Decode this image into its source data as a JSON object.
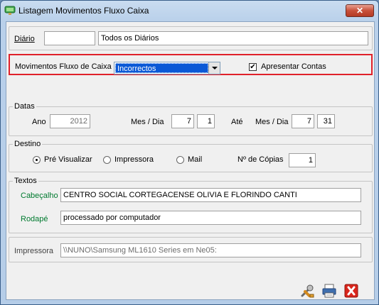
{
  "window": {
    "title": "Listagem Movimentos Fluxo Caixa"
  },
  "diario": {
    "label": "Diário",
    "code": "",
    "name": "Todos os Diários"
  },
  "movimentos": {
    "label": "Movimentos Fluxo de Caixa",
    "selected": "Incorrectos",
    "apresentar_label": "Apresentar Contas",
    "apresentar_checked": "✔"
  },
  "datas": {
    "legend": "Datas",
    "ano_label": "Ano",
    "ano": "2012",
    "mesdia_label": "Mes / Dia",
    "from_mes": "7",
    "from_dia": "1",
    "ate_label": "Até",
    "mesdia2_label": "Mes / Dia",
    "to_mes": "7",
    "to_dia": "31"
  },
  "destino": {
    "legend": "Destino",
    "options": [
      "Pré Visualizar",
      "Impressora",
      "Mail"
    ],
    "selected_index": 0,
    "copias_label": "Nº de Cópias",
    "copias": "1"
  },
  "textos": {
    "legend": "Textos",
    "cabecalho_label": "Cabeçalho",
    "cabecalho": "CENTRO SOCIAL CORTEGACENSE OLIVIA E FLORINDO CANTI",
    "rodape_label": "Rodapé",
    "rodape": "processado por computador"
  },
  "impressora": {
    "label": "Impressora",
    "value": "\\\\NUNO\\Samsung ML1610 Series em Ne05:"
  },
  "colors": {
    "highlight": "#e0212a",
    "label_green": "#007a2f",
    "selection": "#0a58d6"
  },
  "toolbar": {
    "icons": [
      "tools-icon",
      "printer-icon",
      "close-icon"
    ]
  }
}
